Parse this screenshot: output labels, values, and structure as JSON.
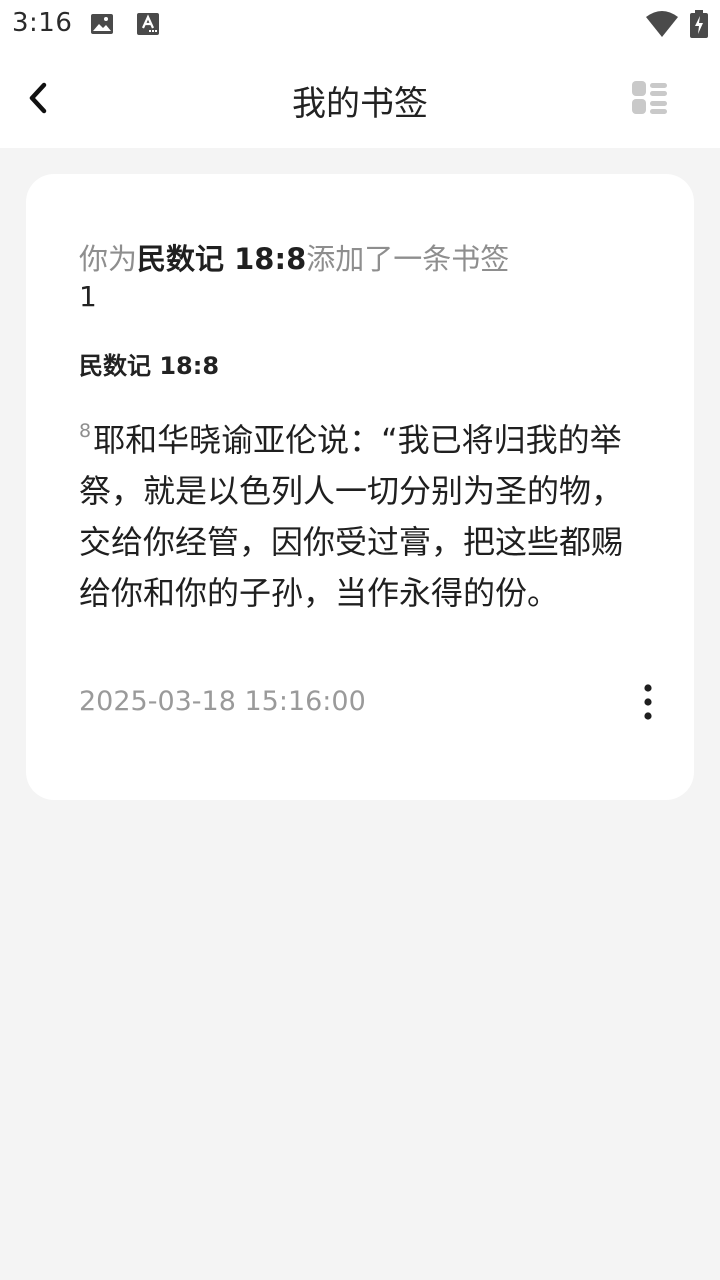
{
  "status_bar": {
    "time": "3:16",
    "icons": [
      "image-icon",
      "a-accessibility-icon",
      "wifi-icon",
      "battery-icon"
    ]
  },
  "header": {
    "title": "我的书签",
    "back_icon": "back-chevron-icon",
    "layout_icon": "list-layout-icon"
  },
  "bookmark": {
    "prefix": "你为",
    "reference": "民数记 18:8",
    "suffix": "添加了一条书签",
    "note": "1",
    "verse_reference": "民数记 18:8",
    "verse_number": "8",
    "verse_text": "耶和华晓谕亚伦说：“我已将归我的举祭，就是以色列人一切分别为圣的物，交给你经管，因你受过膏，把这些都赐给你和你的子孙，当作永得的份。",
    "timestamp": "2025-03-18 15:16:00",
    "more_icon": "more-vertical-icon"
  },
  "colors": {
    "background": "#f4f4f4",
    "card": "#ffffff",
    "muted_text": "#8e8e8e",
    "primary_text": "#1f1f1f"
  }
}
